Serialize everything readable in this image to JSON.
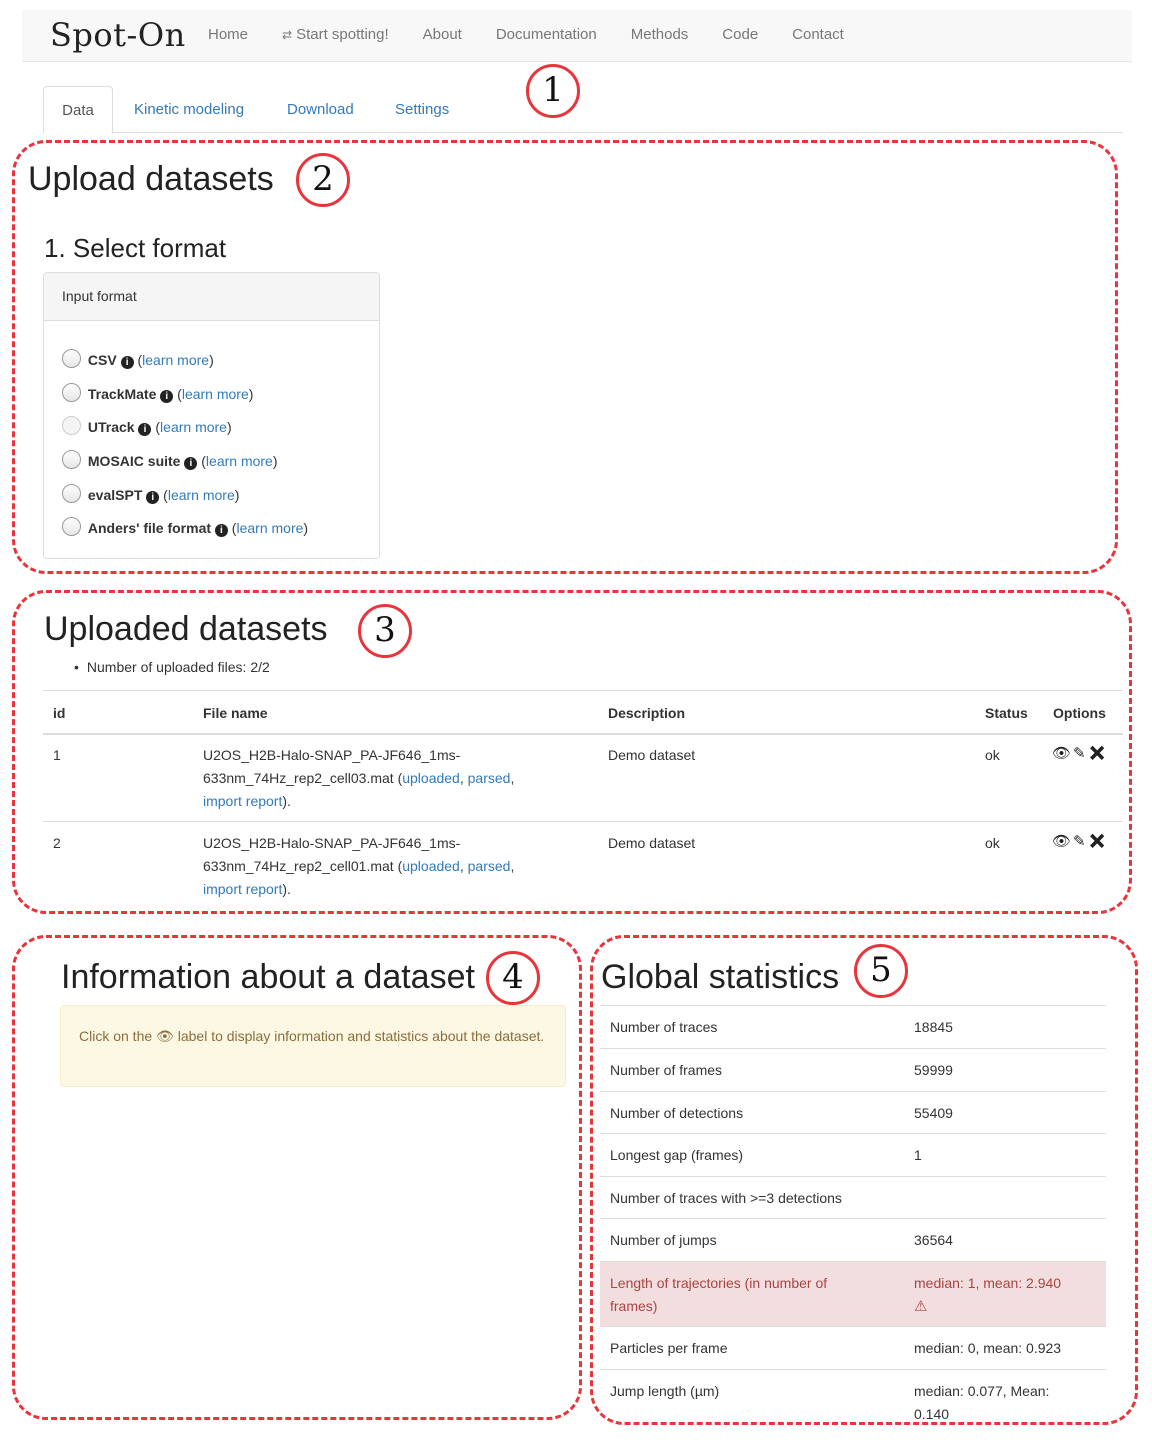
{
  "brand": "Spot-On",
  "nav": {
    "items": [
      "Home",
      "Start spotting!",
      "About",
      "Documentation",
      "Methods",
      "Code",
      "Contact"
    ]
  },
  "tabs": [
    "Data",
    "Kinetic modeling",
    "Download",
    "Settings"
  ],
  "annotations": [
    "1",
    "2",
    "3",
    "4",
    "5"
  ],
  "upload": {
    "title": "Upload datasets",
    "step": "1. Select format",
    "panel_title": "Input format",
    "formats": [
      {
        "name": "CSV",
        "link": "learn more"
      },
      {
        "name": "TrackMate",
        "link": "learn more"
      },
      {
        "name": "UTrack",
        "link": "learn more"
      },
      {
        "name": "MOSAIC suite",
        "link": "learn more"
      },
      {
        "name": "evalSPT",
        "link": "learn more"
      },
      {
        "name": "Anders' file format",
        "link": "learn more"
      }
    ]
  },
  "uploaded": {
    "title": "Uploaded datasets",
    "count_text": "Number of uploaded files: 2/2",
    "columns": [
      "id",
      "File name",
      "Description",
      "Status",
      "Options"
    ],
    "rows": [
      {
        "id": "1",
        "file_l1": "U2OS_H2B-Halo-SNAP_PA-JF646_1ms-",
        "file_l2": "633nm_74Hz_rep2_cell03.mat (",
        "link_uploaded": "uploaded",
        "link_parsed": "parsed",
        "link_report": "import report",
        "description": "Demo dataset",
        "status": "ok"
      },
      {
        "id": "2",
        "file_l1": "U2OS_H2B-Halo-SNAP_PA-JF646_1ms-",
        "file_l2": "633nm_74Hz_rep2_cell01.mat (",
        "link_uploaded": "uploaded",
        "link_parsed": "parsed",
        "link_report": "import report",
        "description": "Demo dataset",
        "status": "ok"
      }
    ]
  },
  "info": {
    "title": "Information about a dataset",
    "alert_before": "Click on the",
    "alert_after": "label to display information and statistics about the dataset."
  },
  "stats": {
    "title": "Global statistics",
    "rows": [
      {
        "k": "Number of traces",
        "v": "18845"
      },
      {
        "k": "Number of frames",
        "v": "59999"
      },
      {
        "k": "Number of detections",
        "v": "55409"
      },
      {
        "k": "Longest gap (frames)",
        "v": "1"
      },
      {
        "k": "Number of traces with >=3 detections",
        "v": ""
      },
      {
        "k": "Number of jumps",
        "v": "36564"
      },
      {
        "k": "Length of trajectories (in number of frames)",
        "v": "median: 1, mean: 2.940"
      },
      {
        "k": "Particles per frame",
        "v": "median: 0, mean: 0.923"
      },
      {
        "k": "Jump length (µm)",
        "v": "median: 0.077, Mean: 0.140"
      }
    ]
  }
}
